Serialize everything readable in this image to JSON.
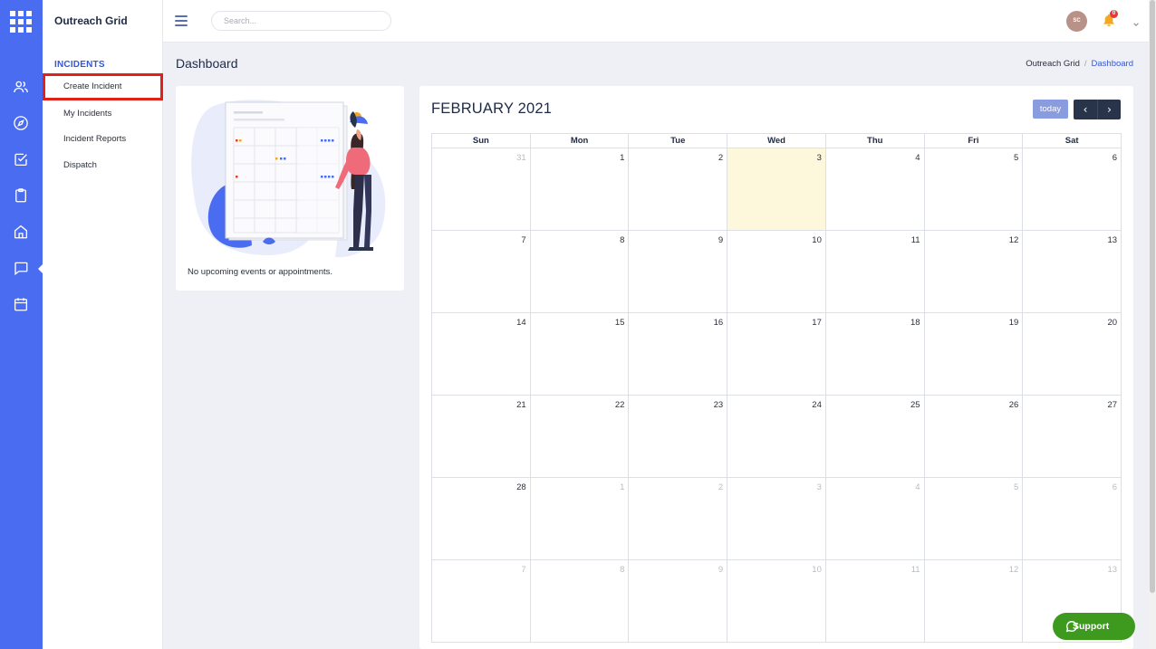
{
  "app": {
    "brand": "Outreach Grid"
  },
  "sidebar": {
    "section_title": "INCIDENTS",
    "items": [
      {
        "label": "Create Incident"
      },
      {
        "label": "My Incidents"
      },
      {
        "label": "Incident Reports"
      },
      {
        "label": "Dispatch"
      }
    ]
  },
  "rail_icons": [
    "users-icon",
    "compass-icon",
    "checkbox-icon",
    "clipboard-icon",
    "home-icon",
    "chat-icon",
    "calendar-icon"
  ],
  "topbar": {
    "search_placeholder": "Search...",
    "avatar_initials": "SC",
    "notification_count": "0"
  },
  "page": {
    "title": "Dashboard",
    "breadcrumb": [
      "Outreach Grid",
      "Dashboard"
    ]
  },
  "events": {
    "empty_message": "No upcoming events or appointments."
  },
  "calendar": {
    "title": "FEBRUARY 2021",
    "today_label": "today",
    "prev_label": "‹",
    "next_label": "›",
    "weekdays": [
      "Sun",
      "Mon",
      "Tue",
      "Wed",
      "Thu",
      "Fri",
      "Sat"
    ],
    "weeks": [
      [
        "31",
        "1",
        "2",
        "3",
        "4",
        "5",
        "6"
      ],
      [
        "7",
        "8",
        "9",
        "10",
        "11",
        "12",
        "13"
      ],
      [
        "14",
        "15",
        "16",
        "17",
        "18",
        "19",
        "20"
      ],
      [
        "21",
        "22",
        "23",
        "24",
        "25",
        "26",
        "27"
      ],
      [
        "28",
        "1",
        "2",
        "3",
        "4",
        "5",
        "6"
      ],
      [
        "7",
        "8",
        "9",
        "10",
        "11",
        "12",
        "13"
      ]
    ],
    "highlight": "3"
  },
  "support": {
    "label": "Support"
  },
  "colors": {
    "primary": "#4a6cf0",
    "today_bg": "#fdf7dc",
    "support": "#3e9a1e",
    "active_outline": "#e22116"
  }
}
